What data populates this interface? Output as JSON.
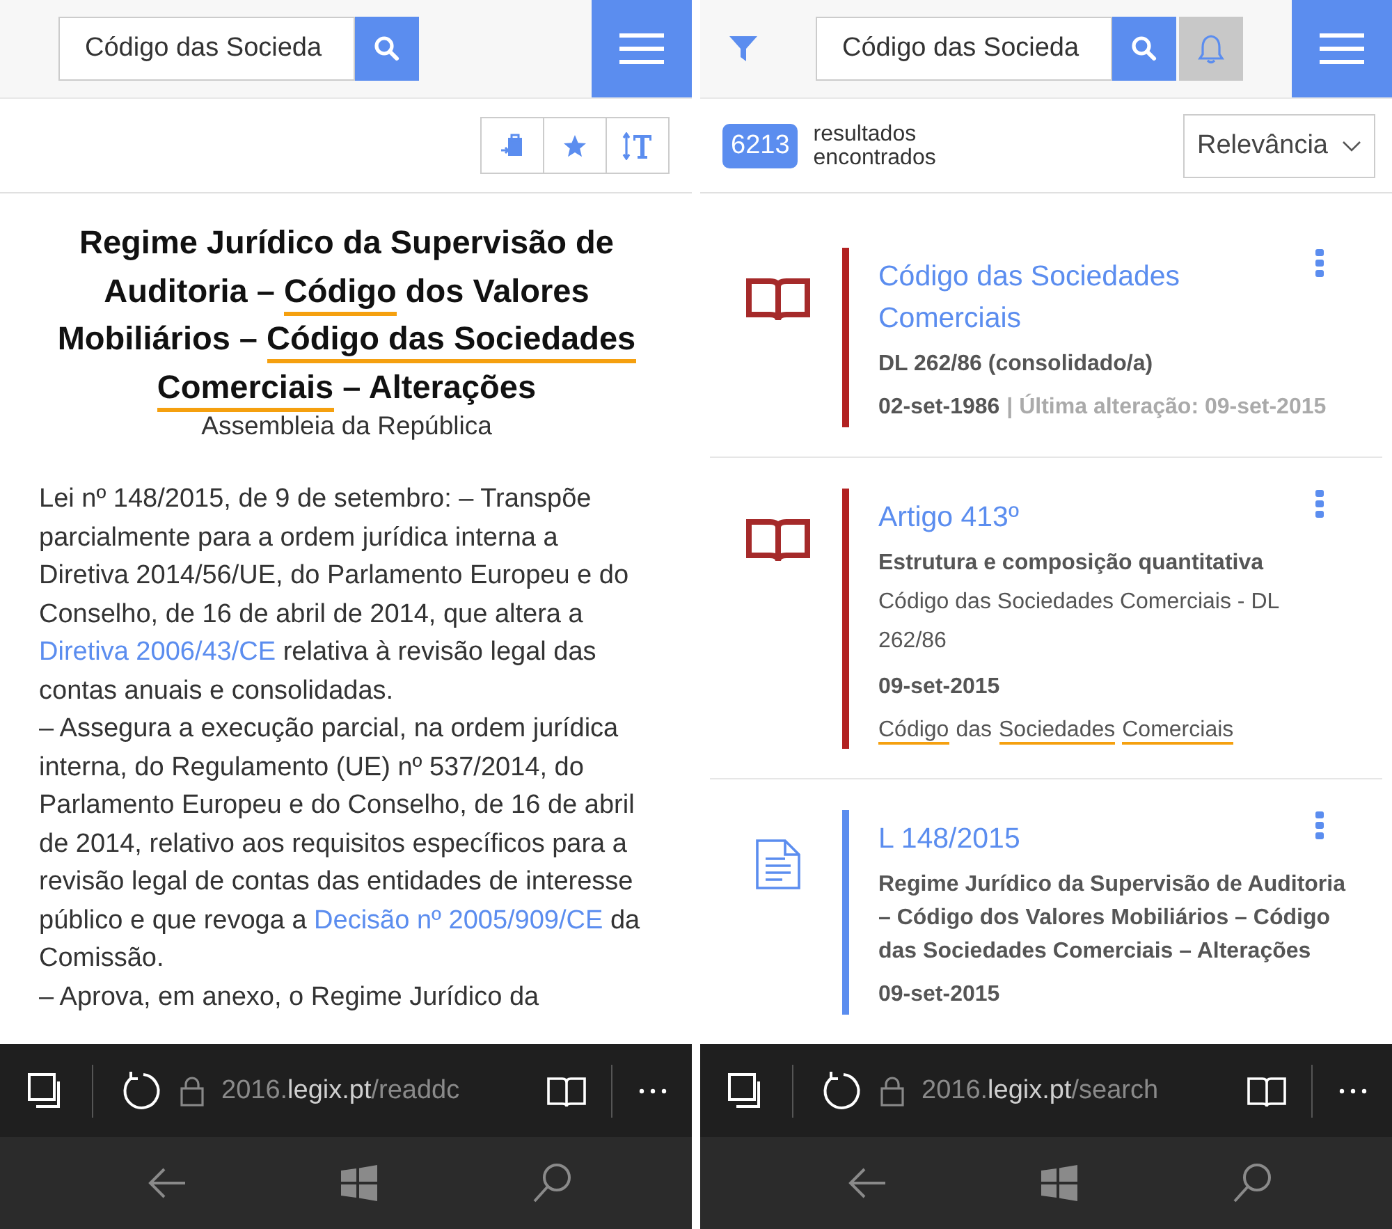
{
  "reader": {
    "search_value": "Código das Socieda",
    "title": [
      {
        "text": "Regime Jurídico da Supervisão de Auditoria – ",
        "highlight": false
      },
      {
        "text": "Código",
        "highlight": true
      },
      {
        "text": " dos Valores Mobiliários – ",
        "highlight": false
      },
      {
        "text": "Código das Sociedades Comerciais",
        "highlight": true
      },
      {
        "text": " – Alterações",
        "highlight": false
      }
    ],
    "author": "Assembleia da República",
    "body": [
      [
        {
          "kind": "text",
          "text": "Lei nº 148/2015, de 9 de setembro: – Transpõe parcialmente para a ordem jurídica interna a Diretiva 2014/56/UE, do Parlamento Europeu e do Conselho, de 16 de abril de 2014, que altera a "
        },
        {
          "kind": "link",
          "text": "Diretiva 2006/43/CE"
        },
        {
          "kind": "text",
          "text": " relativa à revisão legal das contas anuais e consolidadas."
        }
      ],
      [
        {
          "kind": "text",
          "text": "– Assegura a execução parcial, na ordem jurídica interna, do Regulamento (UE) nº 537/2014, do Parlamento Europeu e do Conselho, de 16 de abril de 2014, relativo aos requisitos específicos para a revisão legal de contas das entidades de interesse público e que revoga a "
        },
        {
          "kind": "link",
          "text": "Decisão nº 2005/909/CE"
        },
        {
          "kind": "text",
          "text": " da Comissão."
        }
      ],
      [
        {
          "kind": "text",
          "text": "– Aprova, em anexo, o Regime Jurídico da"
        }
      ]
    ],
    "url": {
      "prefix": "2016.",
      "domain": "legix.pt",
      "path": "/readdc"
    }
  },
  "results": {
    "search_value": "Código das Socieda",
    "count": "6213",
    "count_label": "resultados encontrados",
    "sort": "Relevância",
    "items": [
      {
        "kind": "book",
        "color": "#b22222",
        "title": "Código das Sociedades Comerciais",
        "subtitle": "DL 262/86 (consolidado/a)",
        "date": "02-set-1986",
        "last_change": "| Última alteração: 09-set-2015"
      },
      {
        "kind": "book",
        "color": "#b22222",
        "title": "Artigo 413º",
        "subtitle": "Estrutura e composição quantitativa",
        "source": "Código das Sociedades Comerciais - DL 262/86",
        "date": "09-set-2015",
        "tags": [
          {
            "text": "Código",
            "highlight": true
          },
          {
            "text": "das",
            "highlight": false
          },
          {
            "text": "Sociedades",
            "highlight": true
          },
          {
            "text": "Comerciais",
            "highlight": true
          }
        ]
      },
      {
        "kind": "document",
        "color": "#5b8def",
        "title": "L 148/2015",
        "subtitle": "Regime Jurídico da Supervisão de Auditoria – Código dos Valores Mobiliários – Código das Sociedades Comerciais – Alterações",
        "date": "09-set-2015"
      }
    ],
    "url": {
      "prefix": "2016.",
      "domain": "legix.pt",
      "path": "/search"
    }
  }
}
